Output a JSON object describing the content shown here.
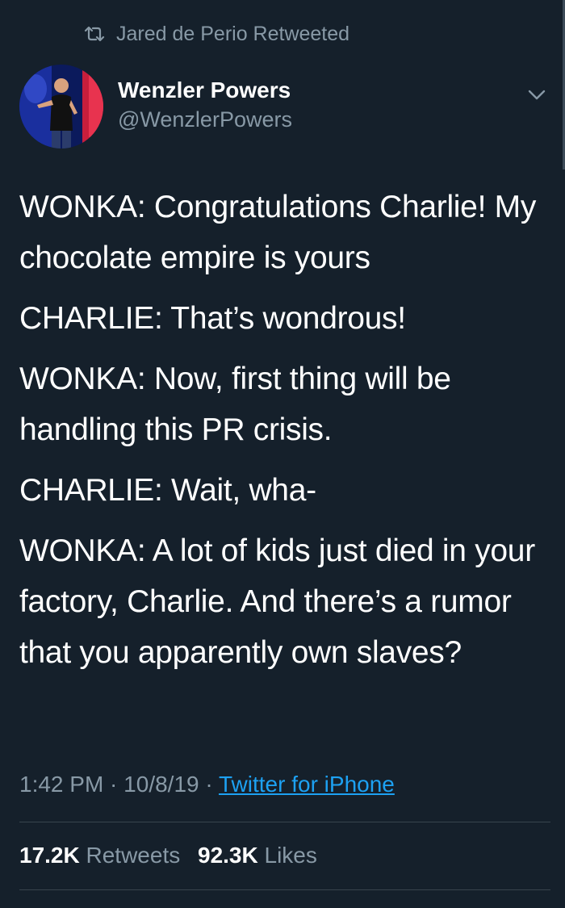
{
  "retweet_context": {
    "icon": "retweet-icon",
    "text": "Jared de Perio Retweeted"
  },
  "author": {
    "name": "Wenzler Powers",
    "handle": "@WenzlerPowers",
    "avatar_icon": "avatar-photo"
  },
  "menu": {
    "icon": "chevron-down-icon"
  },
  "tweet": {
    "paragraphs": [
      "WONKA: Congratulations Charlie! My chocolate empire is yours",
      "CHARLIE: That’s wondrous!",
      "WONKA: Now, first thing will be handling this PR crisis.",
      "CHARLIE: Wait, wha-",
      "WONKA: A lot of kids just died in your factory, Charlie. And there’s a rumor that you apparently own slaves?"
    ]
  },
  "meta": {
    "time": "1:42 PM",
    "sep1": " · ",
    "date": "10/8/19",
    "sep2": " · ",
    "source": "Twitter for iPhone"
  },
  "stats": {
    "retweets_count": "17.2K",
    "retweets_label": "Retweets",
    "likes_count": "92.3K",
    "likes_label": "Likes"
  },
  "colors": {
    "background": "#15202b",
    "secondary_text": "#8899a6",
    "link": "#1da1f2",
    "divider": "#38444d"
  }
}
